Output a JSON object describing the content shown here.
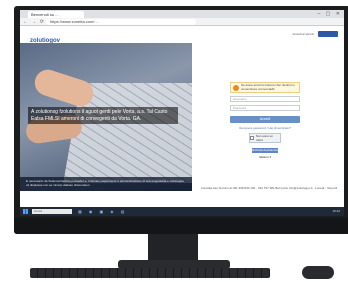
{
  "browser": {
    "tab_title": "Benvenuti su ...",
    "url": "https://www.zonetta.com/...",
    "win_controls": "– ▢ ✕",
    "nav_icons": "← → ⟳"
  },
  "header": {
    "logo_main": "zolutiogov",
    "logo_sub": "Il portale dei servizi",
    "link_label": "Accedi ai servizi"
  },
  "hero": {
    "caption": "A zolutionsg fzolutions il aguot gerdi pele Vorta, a.s. Tal Casto Ealsa FMLSI ameroni di convegenti da Vorta. GA.",
    "footer": "E necessario da Sulamestrazione posseder e, s'olunsto papermento e amministrazione di sua emgestarla e visioneppe vd dispiasse non se nimerp dadaso cbaconaten."
  },
  "login": {
    "notice": "Se avete ancorra instrent chei riterlorsi u comentivore conrecotadit",
    "username_placeholder": "Username",
    "password_placeholder": "Password",
    "submit_label": "Accedi",
    "forgot_label": "Recupera password / Hai dimenticato?",
    "captcha_label": "Non sono un robot",
    "help_label": "Richiedi Assistenza",
    "lang_label": "Italiano ▾"
  },
  "contact": {
    "text": "Contatta Ass.Tecnico al 031 398 840 100 · 342 797 981 Bell porto info@zolutiogov.it · Lunedì - Venerdì"
  },
  "taskbar": {
    "search_placeholder": "Cerca",
    "apps": "▦ ◉ ▣ ◈ ▤",
    "clock": "10:42"
  },
  "colors": {
    "brand": "#2b5aa8",
    "taskbar": "#1f2a38",
    "warning": "#e88a1a"
  }
}
